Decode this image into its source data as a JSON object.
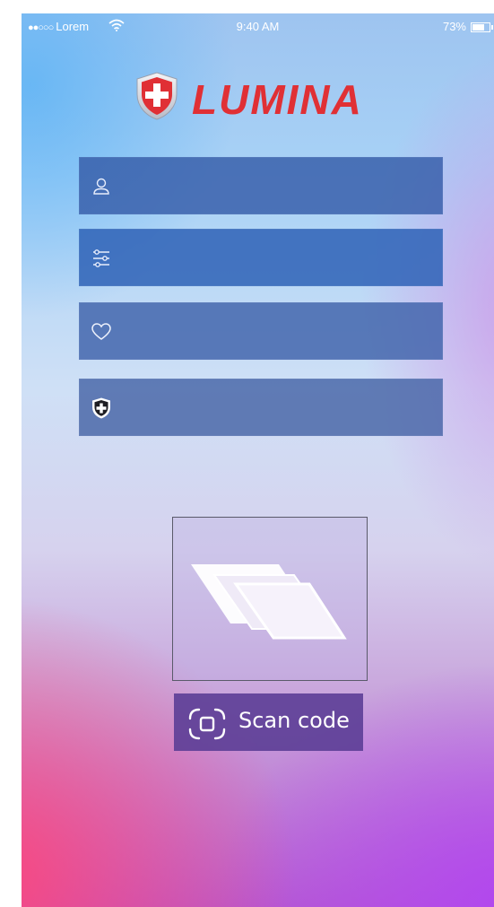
{
  "status_bar": {
    "signal_dots": "●●○○○",
    "carrier": "Lorem",
    "time": "9:40 AM",
    "battery_percent": "73%",
    "battery_level": 0.73
  },
  "logo": {
    "wordmark": "LUMINA",
    "colors": {
      "red": "#e03035",
      "blue": "#3b7bd6"
    }
  },
  "form": {
    "fields": [
      {
        "icon": "user-icon",
        "value": "",
        "placeholder": ""
      },
      {
        "icon": "sliders-icon",
        "value": "",
        "placeholder": ""
      },
      {
        "icon": "heart-icon",
        "value": "",
        "placeholder": ""
      },
      {
        "icon": "medical-shield-icon",
        "value": "",
        "placeholder": ""
      }
    ]
  },
  "scan": {
    "preview_icon": "stacked-cards-icon",
    "button_icon": "scan-frame-icon",
    "button_label": "Scan code"
  }
}
